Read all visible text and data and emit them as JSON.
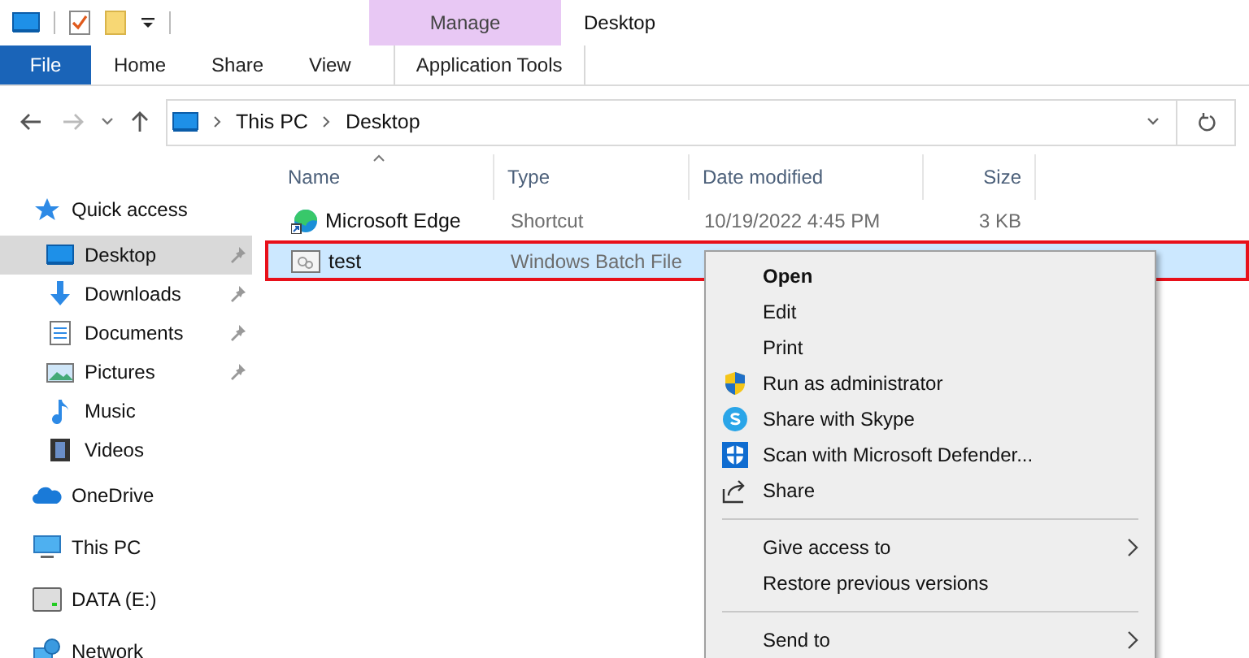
{
  "window": {
    "title": "Desktop"
  },
  "ribbon": {
    "context_group": "Manage",
    "tabs": [
      {
        "label": "File",
        "kind": "file"
      },
      {
        "label": "Home",
        "kind": "tab"
      },
      {
        "label": "Share",
        "kind": "tab"
      },
      {
        "label": "View",
        "kind": "tab"
      },
      {
        "label": "Application Tools",
        "kind": "contextual"
      }
    ]
  },
  "address_bar": {
    "path": [
      "This PC",
      "Desktop"
    ]
  },
  "sidebar": {
    "items": [
      {
        "label": "Quick access",
        "selected": false,
        "children": [
          {
            "label": "Desktop",
            "selected": true,
            "pinned": true
          },
          {
            "label": "Downloads",
            "selected": false,
            "pinned": true
          },
          {
            "label": "Documents",
            "selected": false,
            "pinned": true
          },
          {
            "label": "Pictures",
            "selected": false,
            "pinned": true
          },
          {
            "label": "Music",
            "selected": false,
            "pinned": false
          },
          {
            "label": "Videos",
            "selected": false,
            "pinned": false
          }
        ]
      },
      {
        "label": "OneDrive",
        "selected": false
      },
      {
        "label": "This PC",
        "selected": false
      },
      {
        "label": "DATA (E:)",
        "selected": false
      },
      {
        "label": "Network",
        "selected": false
      }
    ]
  },
  "table": {
    "columns": [
      {
        "label": "Name",
        "sorted": true
      },
      {
        "label": "Type",
        "sorted": false
      },
      {
        "label": "Date modified",
        "sorted": false
      },
      {
        "label": "Size",
        "sorted": false
      }
    ],
    "rows": [
      {
        "name": "Microsoft Edge",
        "type": "Shortcut",
        "date": "10/19/2022 4:45 PM",
        "size": "3 KB",
        "selected": false,
        "highlighted": false
      },
      {
        "name": "test",
        "type": "Windows Batch File",
        "selected": true,
        "highlighted": true
      }
    ]
  },
  "context_menu": {
    "groups": [
      [
        {
          "label": "Open",
          "default": true,
          "submenu": false
        },
        {
          "label": "Edit",
          "default": false,
          "submenu": false
        },
        {
          "label": "Print",
          "default": false,
          "submenu": false
        },
        {
          "label": "Run as administrator",
          "default": false,
          "submenu": false
        },
        {
          "label": "Share with Skype",
          "default": false,
          "submenu": false
        },
        {
          "label": "Scan with Microsoft Defender...",
          "default": false,
          "submenu": false
        },
        {
          "label": "Share",
          "default": false,
          "submenu": false
        }
      ],
      [
        {
          "label": "Give access to",
          "default": false,
          "submenu": true
        },
        {
          "label": "Restore previous versions",
          "default": false,
          "submenu": false
        }
      ],
      [
        {
          "label": "Send to",
          "default": false,
          "submenu": true
        }
      ]
    ]
  }
}
